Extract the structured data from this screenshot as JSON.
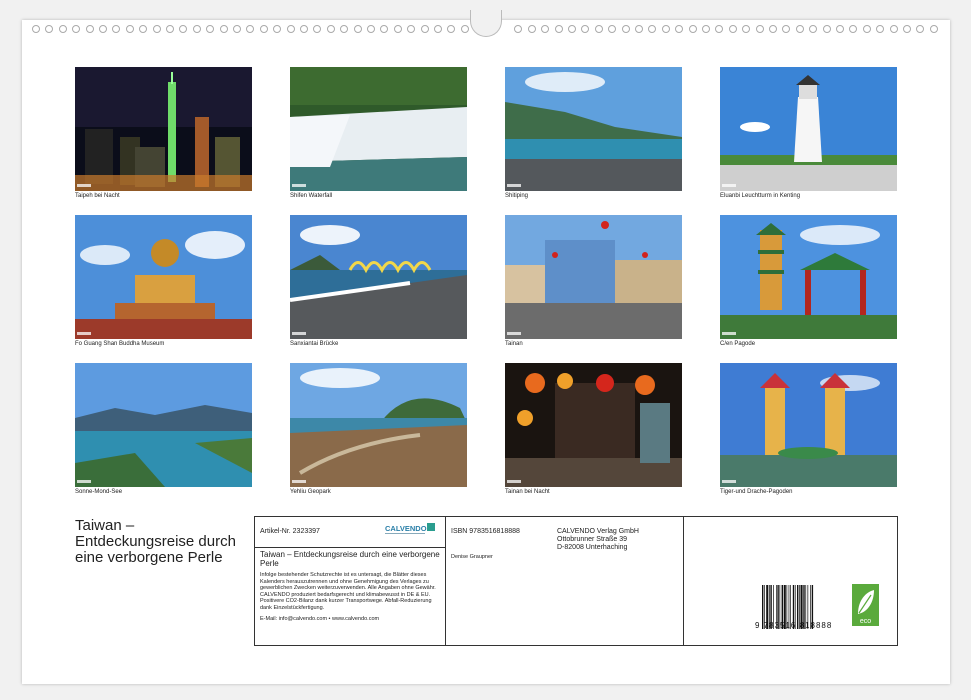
{
  "photos": [
    {
      "caption": "Taipeh bei Nacht",
      "theme": "night-city"
    },
    {
      "caption": "Shifen Waterfall",
      "theme": "waterfall"
    },
    {
      "caption": "Shitiping",
      "theme": "coast"
    },
    {
      "caption": "Eluanbi Leuchtturm in Kenting",
      "theme": "lighthouse"
    },
    {
      "caption": "Fo Guang Shan Buddha Museum",
      "theme": "buddha"
    },
    {
      "caption": "Sanxiantai Brücke",
      "theme": "bridge"
    },
    {
      "caption": "Tainan",
      "theme": "street"
    },
    {
      "caption": "C/en Pagode",
      "theme": "pagoda"
    },
    {
      "caption": "Sonne-Mond-See",
      "theme": "lake"
    },
    {
      "caption": "Yehliu Geopark",
      "theme": "geopark"
    },
    {
      "caption": "Tainan bei Nacht",
      "theme": "night-market"
    },
    {
      "caption": "Tiger-und Drache-Pagoden",
      "theme": "twin-pagodas"
    }
  ],
  "calendar": {
    "title": "Taiwan – Entdeckungsreise durch eine verborgene Perle",
    "article_no": "Artikel-Nr. 2323397",
    "subtitle": "Taiwan – Entdeckungsreise durch eine verborgene Perle",
    "legal": "Infolge bestehender Schutzrechte ist es untersagt, die Blätter dieses Kalenders herauszutrennen und ohne Genehmigung des Verlages zu gewerblichen Zwecken weiterzuverwenden. Alle Angaben ohne Gewähr. CALVENDO produziert bedarfsgerecht und klimabewusst in DE & EU. Positivere CO2-Bilanz dank kurzer Transportwege. Abfall-Reduzierung dank Einzelstückfertigung.",
    "email": "E-Mail: info@calvendo.com • www.calvendo.com",
    "isbn": "ISBN 9783516818888",
    "author": "Denise Graupner",
    "publisher": "CALVENDO Verlag GmbH",
    "street": "Ottobrunner Straße 39",
    "city": "D-82008 Unterhaching",
    "logo": "CALVENDO",
    "barcode_digits": "9 783516 818888",
    "eco_label": "eco"
  }
}
